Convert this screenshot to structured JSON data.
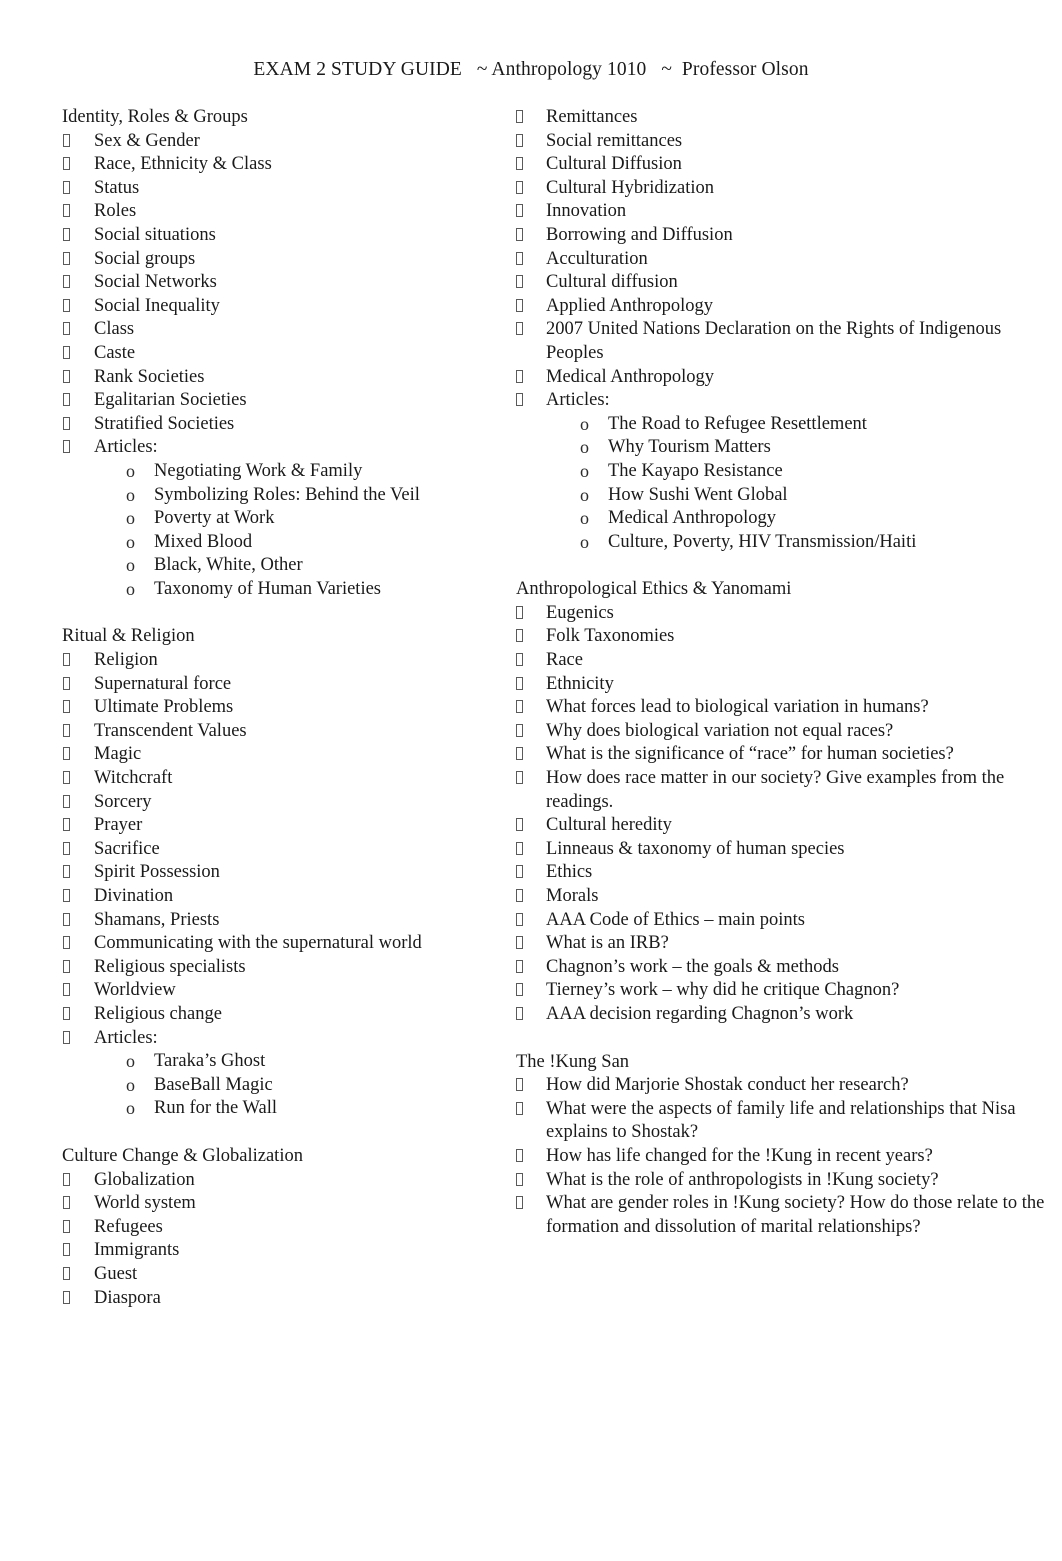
{
  "document": {
    "header": "EXAM 2 STUDY GUIDE   ~ Anthropology 1010   ~  Professor Olson",
    "bullet_glyph_level1": "box-tofu",
    "bullet_glyph_level2": "o"
  },
  "left_column": {
    "sections": [
      {
        "title": "Identity, Roles & Groups",
        "items": [
          {
            "text": "Sex & Gender"
          },
          {
            "text": "Race, Ethnicity & Class"
          },
          {
            "text": "Status"
          },
          {
            "text": "Roles"
          },
          {
            "text": "Social situations"
          },
          {
            "text": "Social groups"
          },
          {
            "text": "Social Networks"
          },
          {
            "text": "Social Inequality"
          },
          {
            "text": "Class"
          },
          {
            "text": "Caste"
          },
          {
            "text": "Rank Societies"
          },
          {
            "text": "Egalitarian Societies"
          },
          {
            "text": "Stratified Societies"
          },
          {
            "text": "Articles:",
            "sub": [
              "Negotiating Work & Family",
              "Symbolizing Roles: Behind the Veil",
              "Poverty at Work",
              "Mixed Blood",
              "Black, White, Other",
              "Taxonomy of Human Varieties"
            ]
          }
        ]
      },
      {
        "title": "Ritual & Religion",
        "items": [
          {
            "text": "Religion"
          },
          {
            "text": "Supernatural force"
          },
          {
            "text": "Ultimate Problems"
          },
          {
            "text": "Transcendent Values"
          },
          {
            "text": "Magic"
          },
          {
            "text": "Witchcraft"
          },
          {
            "text": "Sorcery"
          },
          {
            "text": "Prayer"
          },
          {
            "text": "Sacrifice"
          },
          {
            "text": "Spirit Possession"
          },
          {
            "text": "Divination"
          },
          {
            "text": "Shamans, Priests"
          },
          {
            "text": "Communicating with the supernatural world"
          },
          {
            "text": "Religious specialists"
          },
          {
            "text": "Worldview"
          },
          {
            "text": "Religious change"
          },
          {
            "text": "Articles:",
            "sub": [
              "Taraka’s Ghost",
              "BaseBall Magic",
              "Run for the Wall"
            ]
          }
        ]
      },
      {
        "title": "Culture Change & Globalization",
        "items": [
          {
            "text": "Globalization"
          },
          {
            "text": "World system"
          },
          {
            "text": "Refugees"
          },
          {
            "text": "Immigrants"
          },
          {
            "text": "Guest"
          },
          {
            "text": "Diaspora"
          }
        ]
      }
    ]
  },
  "right_column": {
    "sections": [
      {
        "title": "",
        "items": [
          {
            "text": "Remittances"
          },
          {
            "text": "Social remittances"
          },
          {
            "text": "Cultural Diffusion"
          },
          {
            "text": "Cultural Hybridization"
          },
          {
            "text": "Innovation"
          },
          {
            "text": "Borrowing and Diffusion"
          },
          {
            "text": "Acculturation"
          },
          {
            "text": "Cultural diffusion"
          },
          {
            "text": "Applied Anthropology"
          },
          {
            "text": "2007 United Nations Declaration on the Rights of Indigenous Peoples"
          },
          {
            "text": "Medical Anthropology"
          },
          {
            "text": "Articles:",
            "sub": [
              "The Road to Refugee Resettlement",
              "Why Tourism Matters",
              "The Kayapo Resistance",
              "How Sushi Went Global",
              "Medical Anthropology",
              "Culture, Poverty, HIV Transmission/Haiti"
            ]
          }
        ]
      },
      {
        "title": "Anthropological Ethics & Yanomami",
        "items": [
          {
            "text": "Eugenics"
          },
          {
            "text": "Folk Taxonomies"
          },
          {
            "text": "Race"
          },
          {
            "text": "Ethnicity"
          },
          {
            "text": "What forces lead to biological variation in humans?"
          },
          {
            "text": "Why does biological variation not equal races?"
          },
          {
            "text": "What is the significance of “race” for human societies?"
          },
          {
            "text": "How does race matter in our society? Give examples from the readings."
          },
          {
            "text": "Cultural heredity"
          },
          {
            "text": "Linneaus & taxonomy of human species"
          },
          {
            "text": "Ethics"
          },
          {
            "text": "Morals"
          },
          {
            "text": "AAA Code of Ethics – main points"
          },
          {
            "text": "What is an IRB?"
          },
          {
            "text": "Chagnon’s work – the goals & methods"
          },
          {
            "text": "Tierney’s work – why did he critique Chagnon?"
          },
          {
            "text": "AAA decision regarding Chagnon’s work"
          }
        ]
      },
      {
        "title": "The !Kung San",
        "items": [
          {
            "text": "How did Marjorie Shostak conduct her research?"
          },
          {
            "text": "What were the aspects of family life and relationships that Nisa explains to Shostak?"
          },
          {
            "text": "How has life changed for the !Kung in recent years?"
          },
          {
            "text": "What is the role of anthropologists in !Kung society?"
          },
          {
            "text": "What are gender roles in !Kung society? How do those relate to the formation and dissolution of marital relationships?"
          }
        ]
      }
    ]
  }
}
